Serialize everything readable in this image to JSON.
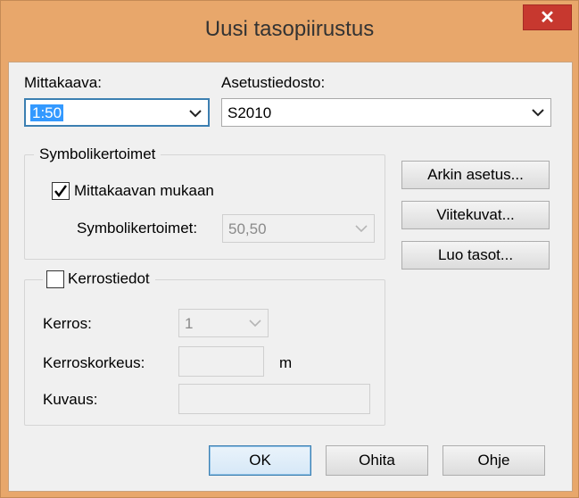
{
  "window": {
    "title": "Uusi tasopiirustus",
    "close_glyph": "✕"
  },
  "scale": {
    "label": "Mittakaava:",
    "value": "1:50"
  },
  "settings_file": {
    "label": "Asetustiedosto:",
    "value": "S2010"
  },
  "symbol_group": {
    "title": "Symbolikertoimet",
    "checkbox_label": "Mittakaavan mukaan",
    "checked": true,
    "field_label": "Symbolikertoimet:",
    "field_value": "50,50"
  },
  "floor_group": {
    "checkbox_label": "Kerrostiedot",
    "checked": false,
    "floor_label": "Kerros:",
    "floor_value": "1",
    "height_label": "Kerroskorkeus:",
    "height_unit": "m",
    "description_label": "Kuvaus:"
  },
  "side_buttons": {
    "sheet_setup": "Arkin asetus...",
    "reference_images": "Viitekuvat...",
    "create_layers": "Luo tasot..."
  },
  "footer_buttons": {
    "ok": "OK",
    "skip": "Ohita",
    "help": "Ohje"
  },
  "colors": {
    "titlebar": "#e8a76b",
    "close": "#c7382f",
    "selection": "#3399ff"
  }
}
